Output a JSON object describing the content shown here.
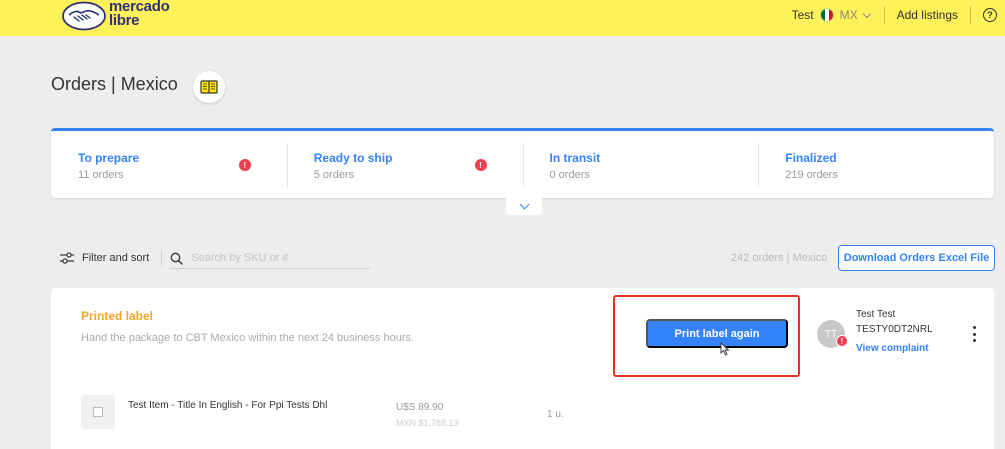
{
  "header": {
    "logo_text_line1": "mercado",
    "logo_text_line2": "libre",
    "user_name": "Test",
    "country": "MX",
    "add_listings": "Add listings",
    "help_glyph": "?",
    "flag_colors": [
      "#006847",
      "#ffffff",
      "#ce1126"
    ]
  },
  "page": {
    "title": "Orders | Mexico"
  },
  "status_tabs": [
    {
      "title": "To prepare",
      "count": "11 orders",
      "alert": "!"
    },
    {
      "title": "Ready to ship",
      "count": "5 orders",
      "alert": "!"
    },
    {
      "title": "In transit",
      "count": "0 orders"
    },
    {
      "title": "Finalized",
      "count": "219 orders"
    }
  ],
  "toolbar": {
    "filter_label": "Filter and sort",
    "search_placeholder": "Search by SKU or #",
    "orders_count": "242 orders | Mexico",
    "download_label": "Download Orders Excel File"
  },
  "order": {
    "status": "Printed label",
    "description": "Hand the package to CBT Mexico within the next 24 business hours.",
    "primary_action": "Print label again",
    "buyer": {
      "initials": "TT",
      "name": "Test Test",
      "id": "TESTY0DT2NRL",
      "alert": "!",
      "complaint_link": "View complaint"
    },
    "item": {
      "title": "Test Item - Title In English - For Ppi Tests Dhl",
      "price_usd": "U$S 89.90",
      "price_mxn": "MXN $1,788.13",
      "quantity": "1 u."
    }
  },
  "colors": {
    "header_bg": "#fff159",
    "accent": "#3483fa",
    "alert": "#f23d4f",
    "status_orange": "#f5a623",
    "highlight_red": "#e63027"
  }
}
